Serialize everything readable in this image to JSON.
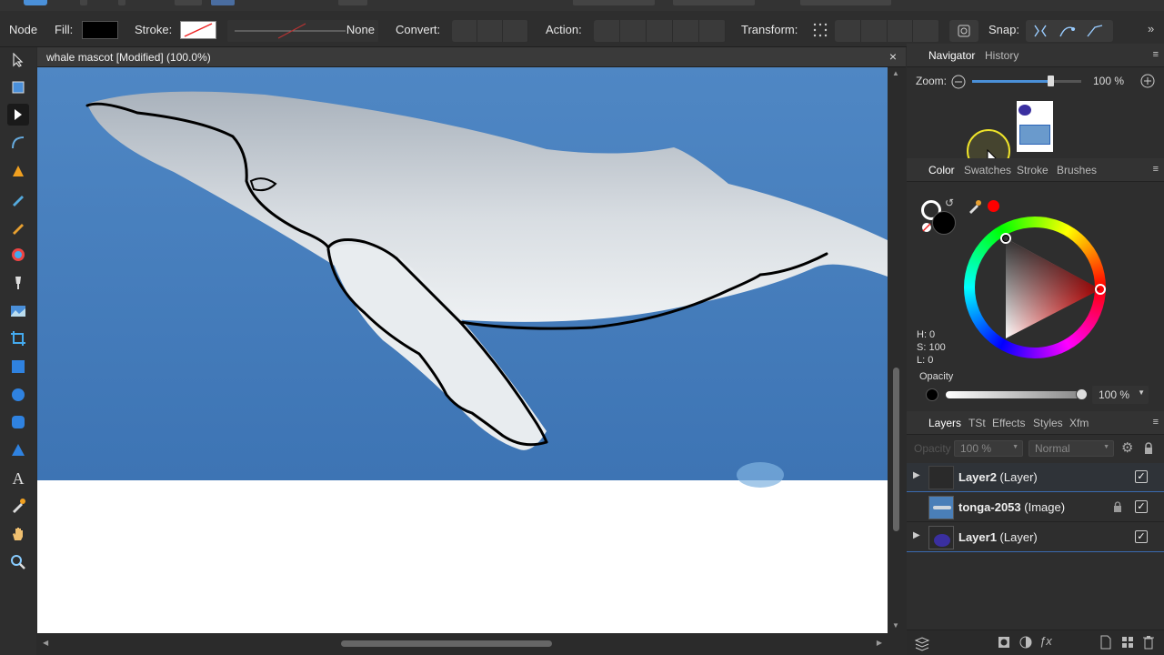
{
  "context_bar": {
    "mode": "Node",
    "fill_label": "Fill:",
    "stroke_label": "Stroke:",
    "stroke_style": "None",
    "convert_label": "Convert:",
    "action_label": "Action:",
    "transform_label": "Transform:",
    "snap_label": "Snap:",
    "fill_color": "#000000"
  },
  "document": {
    "title": "whale mascot [Modified] (100.0%)",
    "close": "×"
  },
  "navigator": {
    "tabs": [
      "Navigator",
      "History"
    ],
    "zoom_label": "Zoom:",
    "zoom_value": "100 %",
    "zoom_level": 0.72
  },
  "color_panel": {
    "tabs": [
      "Color",
      "Swatches",
      "Stroke",
      "Brushes"
    ],
    "h": "H: 0",
    "s": "S: 100",
    "l": "L: 0",
    "opacity_label": "Opacity",
    "opacity_value": "100 %",
    "opacity_level": 1.0,
    "picked_color": "#ff0000"
  },
  "layers_panel": {
    "tabs": [
      "Layers",
      "TSt",
      "Effects",
      "Styles",
      "Xfm"
    ],
    "opacity_dd": "100 %",
    "blend_dd": "Normal",
    "opacity_faded": "Opacity",
    "layers": [
      {
        "name": "Layer2",
        "type": "(Layer)",
        "expander": "▶",
        "visible": "✓"
      },
      {
        "name": "tonga-2053",
        "type": "(Image)",
        "expander": "",
        "visible": "✓",
        "locked": "🔒"
      },
      {
        "name": "Layer1",
        "type": "(Layer)",
        "expander": "▶",
        "visible": "✓"
      }
    ]
  },
  "icons": [
    "pointer-icon",
    "artboard-icon",
    "node-tool-icon",
    "corner-tool-icon",
    "pen-icon",
    "pencil-icon",
    "brush-icon",
    "fill-icon",
    "transparency-icon",
    "image-icon",
    "crop-icon",
    "rectangle-icon",
    "ellipse-icon",
    "rounded-rect-icon",
    "triangle-icon",
    "text-icon",
    "color-picker-icon",
    "hand-icon",
    "zoom-icon"
  ]
}
